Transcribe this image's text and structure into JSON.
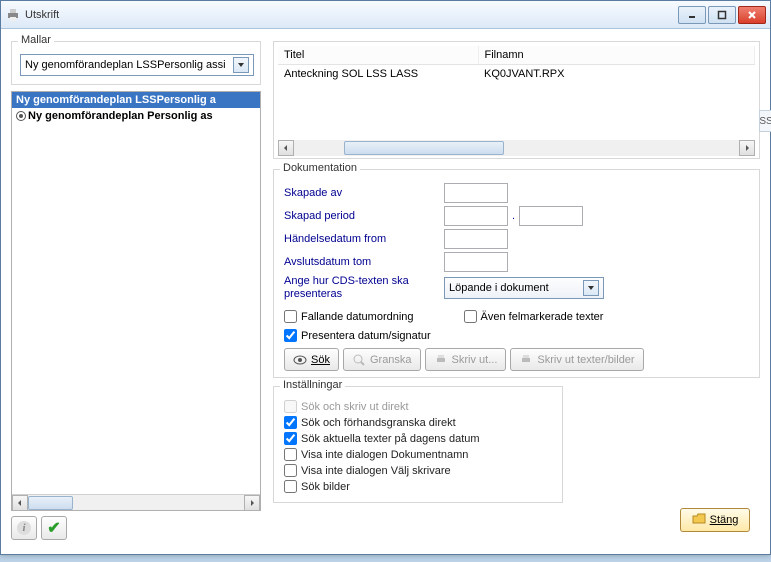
{
  "window": {
    "title": "Utskrift"
  },
  "mallar": {
    "group_title": "Mallar",
    "combo_text": "Ny genomförandeplan LSSPersonlig assi",
    "items": [
      {
        "label": "Ny genomförandeplan LSSPersonlig a"
      },
      {
        "label": "Ny genomförandeplan Personlig as"
      }
    ]
  },
  "table": {
    "headers": {
      "titel": "Titel",
      "filnamn": "Filnamn"
    },
    "row": {
      "titel": "Anteckning SOL LSS LASS",
      "filnamn": "KQ0JVANT.RPX"
    }
  },
  "doc": {
    "group_title": "Dokumentation",
    "skapade_av": "Skapade av",
    "skapad_period": "Skapad period",
    "handelsedatum": "Händelsedatum from",
    "avslut": "Avslutsdatum tom",
    "cds_label": "Ange hur CDS-texten ska presenteras",
    "cds_value": "Löpande i dokument",
    "fallande": "Fallande datumordning",
    "aven_fel": "Även felmarkerade texter",
    "presentera": "Presentera datum/signatur",
    "btn_sok": "Sök",
    "btn_granska": "Granska",
    "btn_skriv": "Skriv ut...",
    "btn_skriv_tb": "Skriv ut texter/bilder"
  },
  "settings": {
    "group_title": "Inställningar",
    "skriv_direkt": "Sök och skriv ut direkt",
    "forhands": "Sök och förhandsgranska direkt",
    "dagens": "Sök aktuella texter på dagens datum",
    "dok_namn": "Visa inte dialogen Dokumentnamn",
    "valj_skrivare": "Visa inte dialogen Välj skrivare",
    "sok_bilder": "Sök bilder"
  },
  "close_label": "Stäng",
  "side_ss": "SS"
}
